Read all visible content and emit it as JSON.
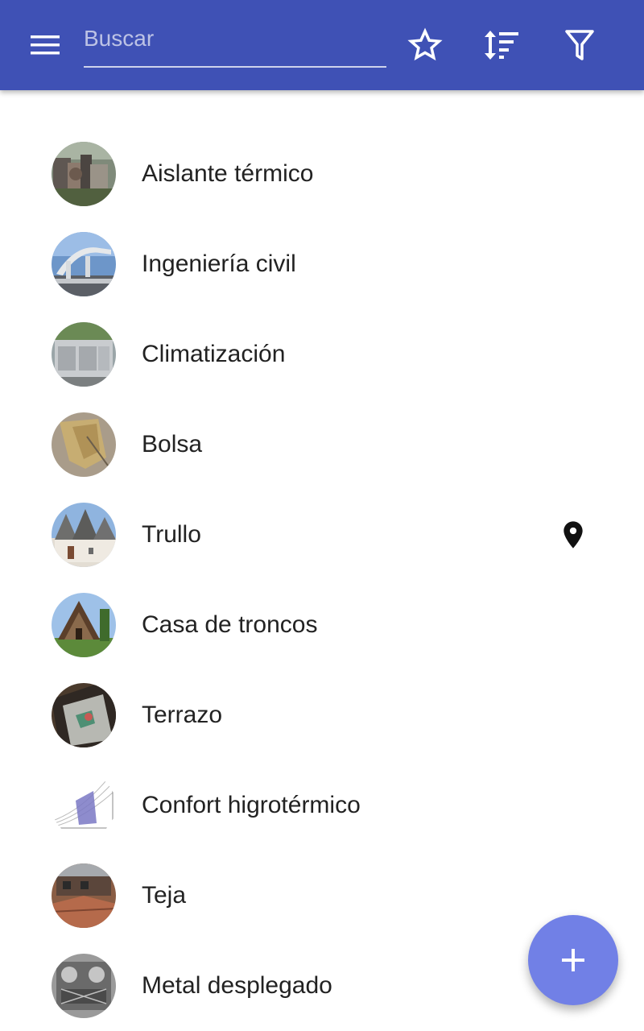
{
  "toolbar": {
    "menu_icon": "menu-icon",
    "search": {
      "placeholder": "Buscar",
      "value": ""
    },
    "actions": [
      {
        "name": "favorites",
        "icon": "star-outline-icon"
      },
      {
        "name": "sort",
        "icon": "sort-icon"
      },
      {
        "name": "filter",
        "icon": "filter-icon"
      }
    ],
    "color": "#3f51b5"
  },
  "items": [
    {
      "label": "Aislante térmico",
      "has_location": false
    },
    {
      "label": "Ingeniería civil",
      "has_location": false
    },
    {
      "label": "Climatización",
      "has_location": false
    },
    {
      "label": "Bolsa",
      "has_location": false
    },
    {
      "label": "Trullo",
      "has_location": true
    },
    {
      "label": "Casa de troncos",
      "has_location": false
    },
    {
      "label": "Terrazo",
      "has_location": false
    },
    {
      "label": "Confort higrotérmico",
      "has_location": false
    },
    {
      "label": "Teja",
      "has_location": false
    },
    {
      "label": "Metal desplegado",
      "has_location": false
    }
  ],
  "fab": {
    "icon": "plus-icon",
    "color": "#7180e6"
  }
}
